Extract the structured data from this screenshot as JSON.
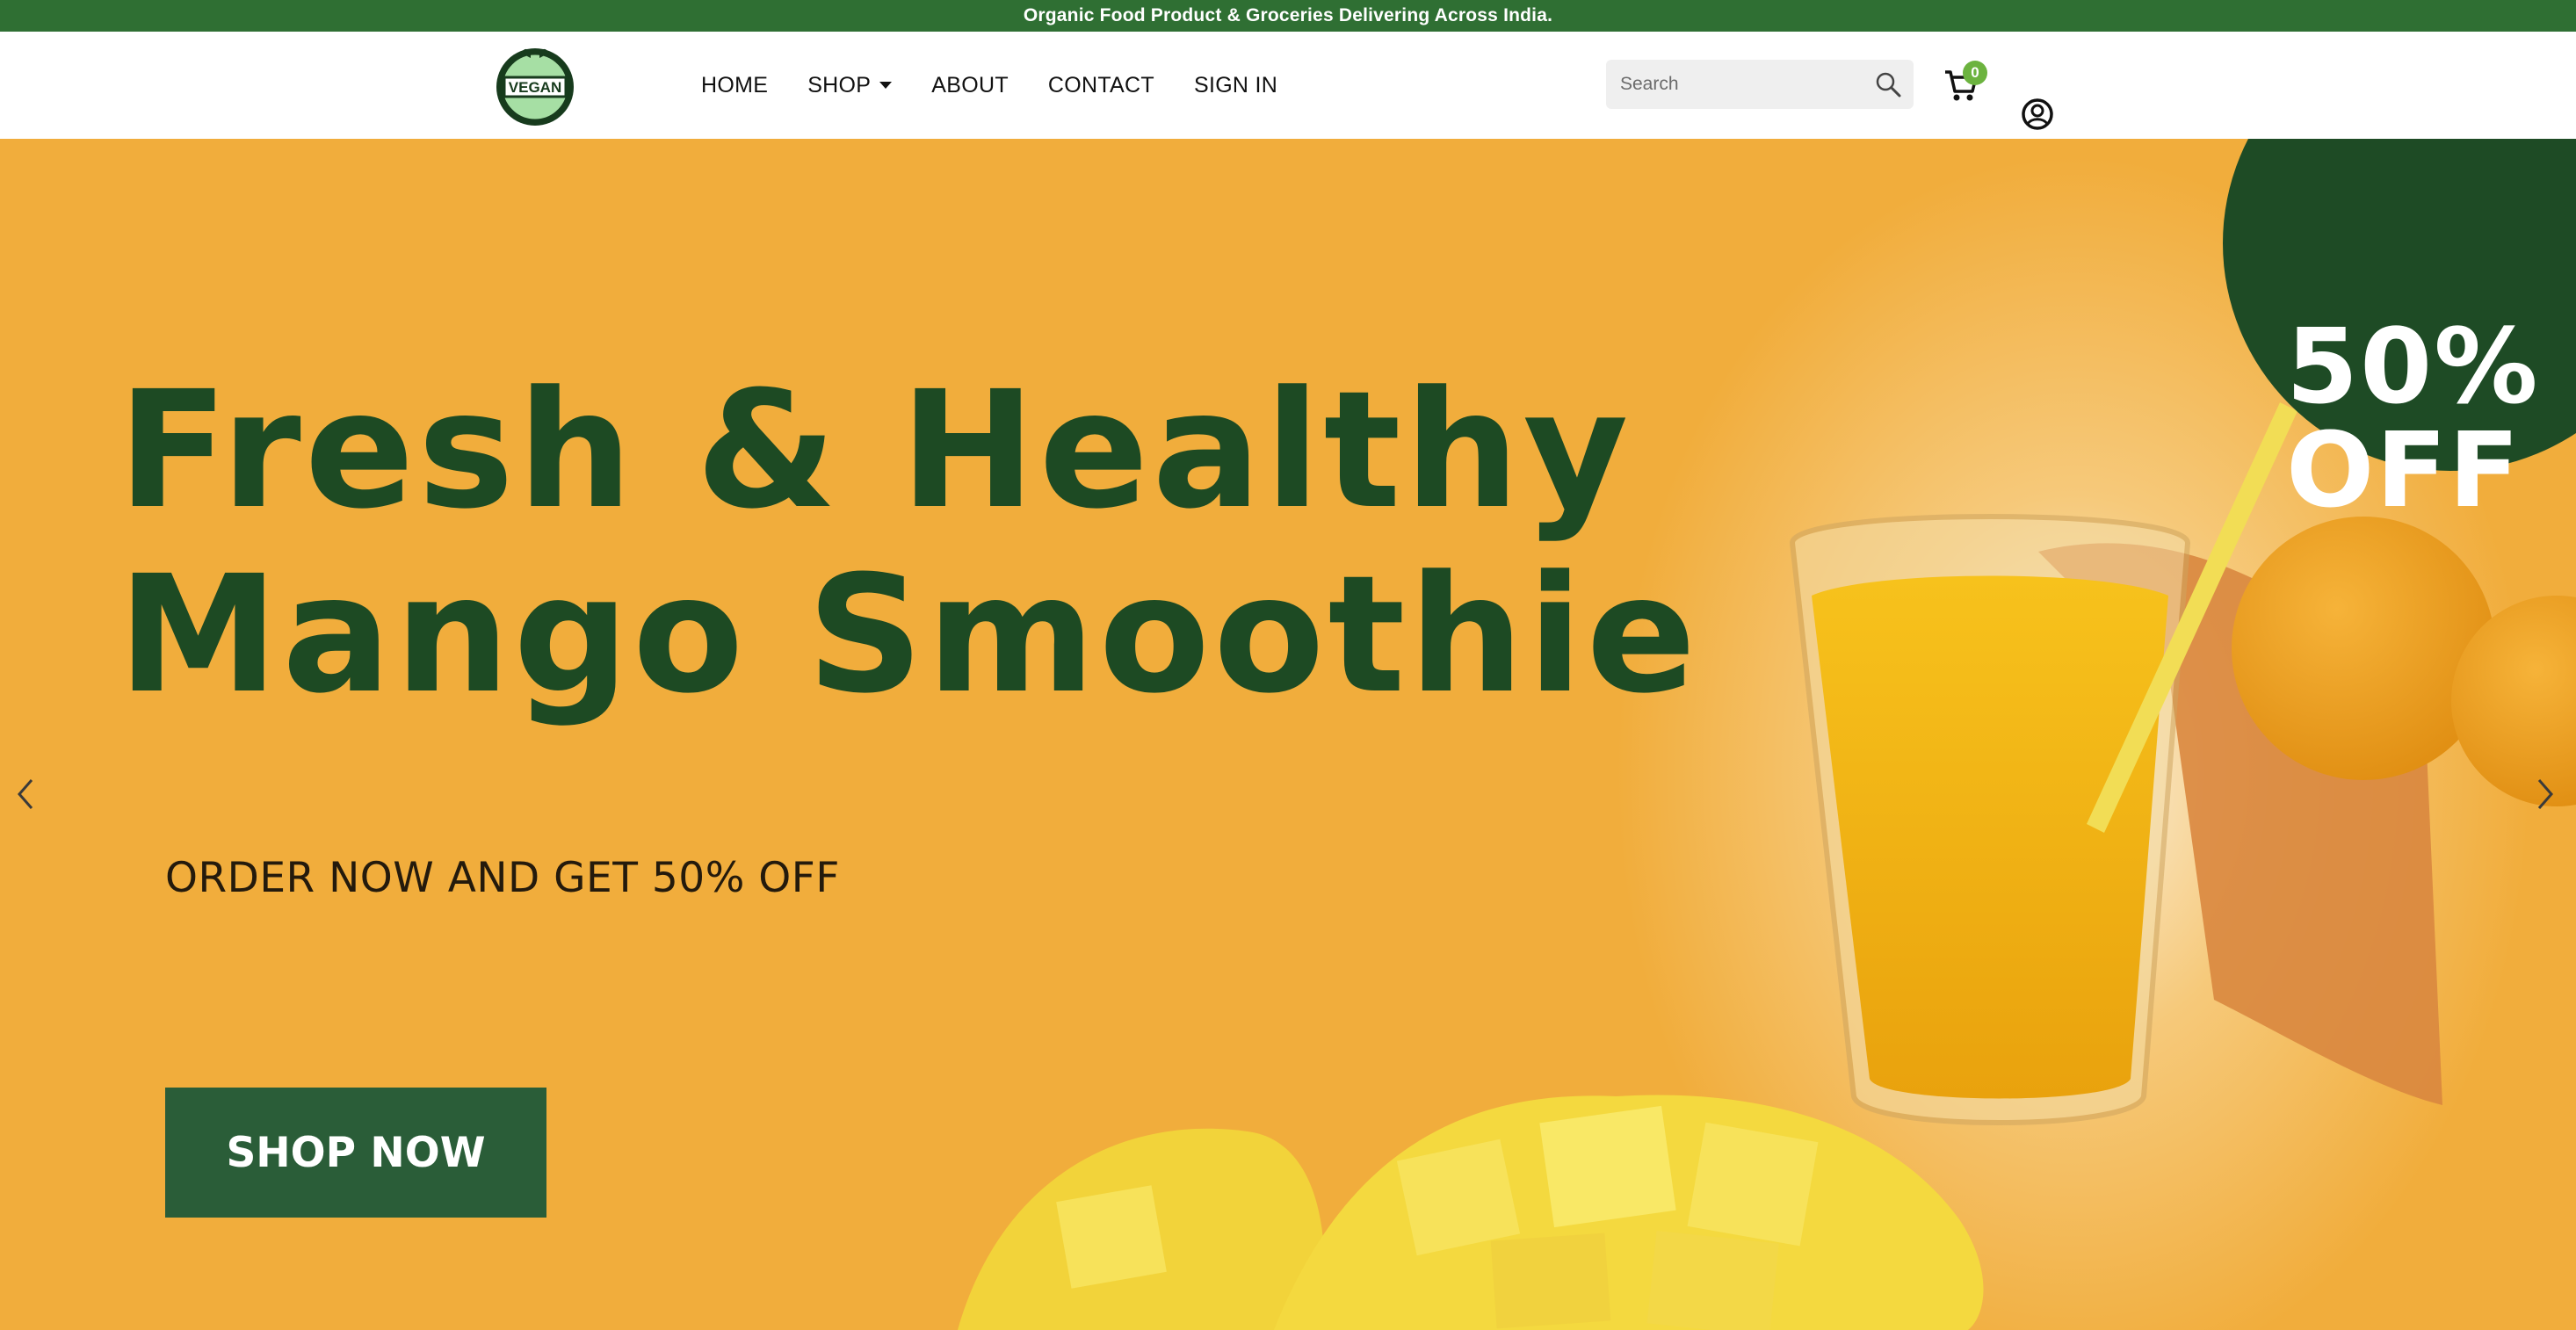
{
  "announcement": "Organic Food Product & Groceries Delivering Across India.",
  "logo": {
    "text": "VEGAN"
  },
  "nav": [
    {
      "label": "HOME"
    },
    {
      "label": "SHOP"
    },
    {
      "label": "ABOUT"
    },
    {
      "label": "CONTACT"
    },
    {
      "label": "SIGN IN"
    }
  ],
  "search": {
    "placeholder": "Search",
    "value": ""
  },
  "cart": {
    "count": "0"
  },
  "hero": {
    "headline_line1": "Fresh & Healthy",
    "headline_line2": "Mango Smoothie",
    "subheadline": "ORDER NOW AND GET 50% OFF",
    "cta": "SHOP NOW",
    "offer_line1": "50%",
    "offer_line2": "OFF"
  },
  "colors": {
    "brand_green": "#2f6f33",
    "dark_green": "#1e4b25",
    "hero_orange": "#f1ad3c",
    "badge_green": "#6cb33f"
  },
  "icons": [
    "leaf-icon",
    "chevron-down-icon",
    "search-icon",
    "cart-icon",
    "account-icon",
    "arrow-left-icon",
    "arrow-right-icon"
  ]
}
